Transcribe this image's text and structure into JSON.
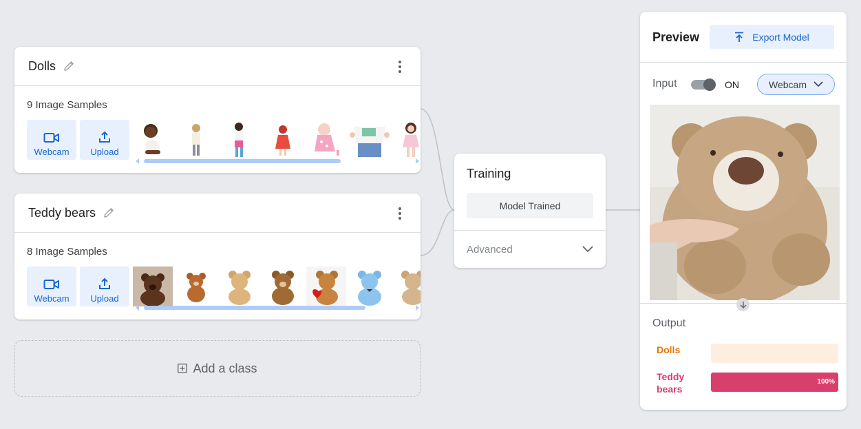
{
  "classes": [
    {
      "name": "Dolls",
      "samples_label": "9 Image Samples",
      "webcam_label": "Webcam",
      "upload_label": "Upload",
      "scroll_fill": 0.76
    },
    {
      "name": "Teddy bears",
      "samples_label": "8 Image Samples",
      "webcam_label": "Webcam",
      "upload_label": "Upload",
      "scroll_fill": 0.83
    }
  ],
  "add_class_label": "Add a class",
  "training": {
    "title": "Training",
    "button_label": "Model Trained",
    "advanced_label": "Advanced"
  },
  "preview": {
    "title": "Preview",
    "export_label": "Export Model",
    "input_label": "Input",
    "toggle_state": "ON",
    "source_label": "Webcam",
    "output_label": "Output",
    "outputs": [
      {
        "name": "Dolls",
        "percent": 0,
        "percent_label": "",
        "color": "#e37400",
        "bg": "#fdeee0"
      },
      {
        "name": "Teddy bears",
        "percent": 100,
        "percent_label": "100%",
        "color": "#d93f6c",
        "bg": "#f9d3de"
      }
    ]
  },
  "colors": {
    "accent": "#1967d2",
    "accent_bg": "#e8f0fe",
    "canvas": "#e8eaed"
  },
  "icons": [
    "pencil-icon",
    "more-vert-icon",
    "videocam-icon",
    "upload-icon",
    "add-box-icon",
    "chevron-down-icon",
    "export-icon",
    "arrow-down-icon"
  ]
}
